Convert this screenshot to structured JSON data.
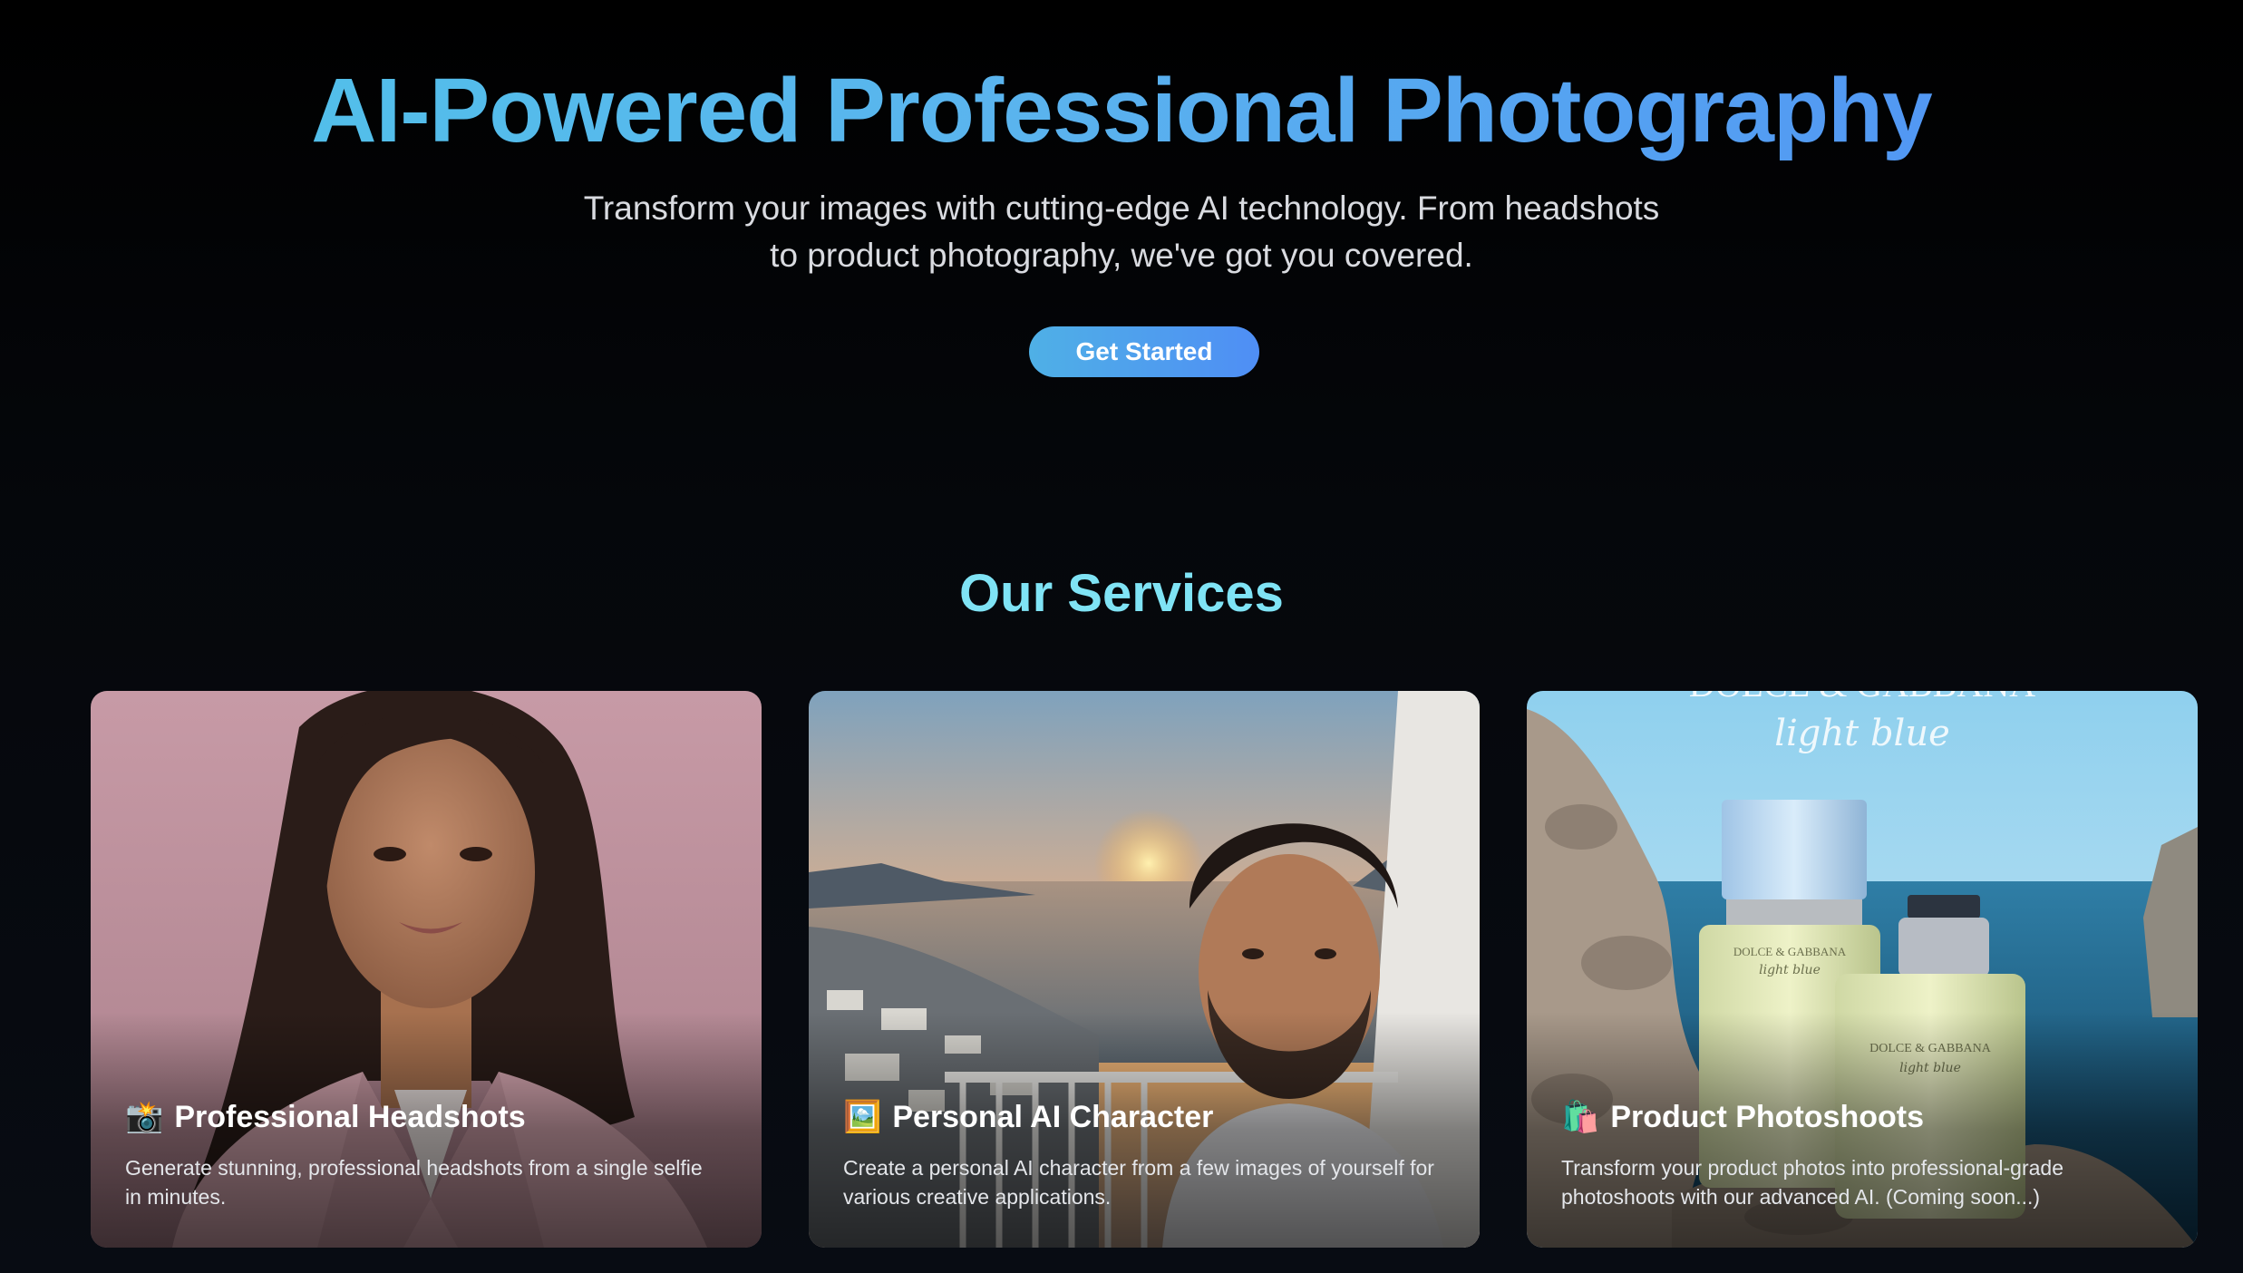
{
  "hero": {
    "title": "AI-Powered Professional Photography",
    "subtitle": "Transform your images with cutting-edge AI technology. From headshots to product photography, we've got you covered.",
    "cta_label": "Get Started"
  },
  "services": {
    "heading": "Our Services",
    "cards": [
      {
        "emoji": "📸",
        "title": "Professional Headshots",
        "description": "Generate stunning, professional headshots from a single selfie in minutes."
      },
      {
        "emoji": "🖼️",
        "title": "Personal AI Character",
        "description": "Create a personal AI character from a few images of yourself for various creative applications."
      },
      {
        "emoji": "🛍️",
        "title": "Product Photoshoots",
        "description": "Transform your product photos into professional-grade photoshoots with our advanced AI. (Coming soon...)",
        "image_text": [
          "DOLCE & GABBANA",
          "light blue"
        ]
      }
    ]
  },
  "colors": {
    "background": "#05070b",
    "title_gradient_start": "#4fc3e8",
    "title_gradient_end": "#4f8ef5",
    "services_heading": "#7fe3f5"
  }
}
